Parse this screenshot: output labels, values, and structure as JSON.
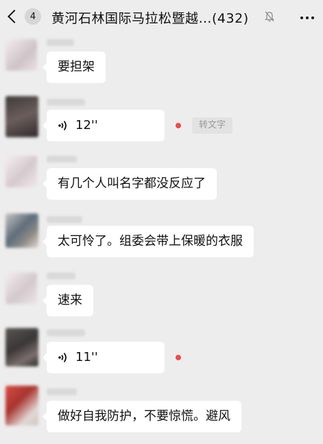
{
  "header": {
    "unread_count": "4",
    "title": "黄河石林国际马拉松暨越…",
    "member_count": "(432)"
  },
  "messages": [
    {
      "type": "text",
      "text": "要担架",
      "avatar_color": "#dcd6d8"
    },
    {
      "type": "voice",
      "duration": "12''",
      "unread": true,
      "transcribe_label": "转文字",
      "avatar_color": "#5c5250"
    },
    {
      "type": "text",
      "text": "有几个人叫名字都没反应了",
      "avatar_color": "#e6dcde"
    },
    {
      "type": "text",
      "text": "太可怜了。组委会带上保暖的衣服",
      "avatar_color": "#6f7a86"
    },
    {
      "type": "text",
      "text": "速来",
      "avatar_color": "#e4dde0"
    },
    {
      "type": "voice",
      "duration": "11''",
      "unread": true,
      "avatar_color": "#4a4644"
    },
    {
      "type": "text",
      "text": "做好自我防护，不要惊慌。避风",
      "avatar_color": "#c0433f"
    }
  ],
  "colors": {
    "background": "#ededed",
    "bubble": "#ffffff",
    "unread_dot": "#f04b4b"
  }
}
